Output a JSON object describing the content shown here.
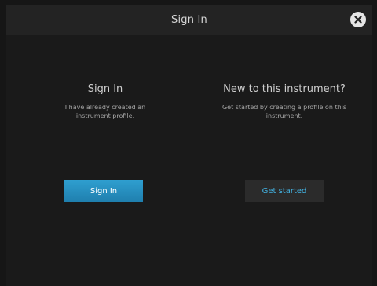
{
  "header": {
    "title": "Sign In",
    "close_icon": "close-icon"
  },
  "sign_in": {
    "title": "Sign In",
    "description": "I have already created an instrument profile.",
    "button_label": "Sign In"
  },
  "new_user": {
    "title": "New to this instrument?",
    "description": "Get started by creating a profile on this instrument.",
    "button_label": "Get started"
  },
  "colors": {
    "accent": "#2a8fc1",
    "link": "#43b3e3",
    "background": "#161616"
  }
}
